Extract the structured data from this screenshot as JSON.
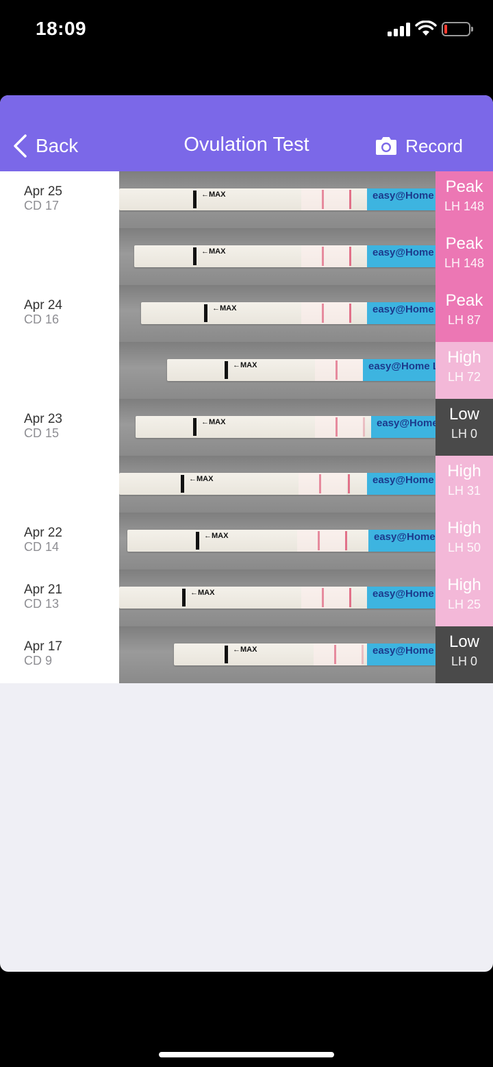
{
  "status_bar": {
    "time": "18:09"
  },
  "nav": {
    "back_label": "Back",
    "title": "Ovulation Test",
    "record_label": "Record"
  },
  "colors": {
    "nav": "#7b68e8",
    "peak": "#ec77b4",
    "high": "#f3b8d8",
    "low": "#4a4a4a"
  },
  "strip_text": {
    "max": "←MAX",
    "brand": "easy@Home LH"
  },
  "tests": [
    {
      "date": "Apr 25",
      "cd": "CD 17",
      "level": "Peak",
      "lh": "LH 148"
    },
    {
      "date": "",
      "cd": "",
      "level": "Peak",
      "lh": "LH 148"
    },
    {
      "date": "Apr 24",
      "cd": "CD 16",
      "level": "Peak",
      "lh": "LH 87"
    },
    {
      "date": "",
      "cd": "",
      "level": "High",
      "lh": "LH 72"
    },
    {
      "date": "Apr 23",
      "cd": "CD 15",
      "level": "Low",
      "lh": "LH 0"
    },
    {
      "date": "",
      "cd": "",
      "level": "High",
      "lh": "LH 31"
    },
    {
      "date": "Apr 22",
      "cd": "CD 14",
      "level": "High",
      "lh": "LH 50"
    },
    {
      "date": "Apr 21",
      "cd": "CD 13",
      "level": "High",
      "lh": "LH 25"
    },
    {
      "date": "Apr 17",
      "cd": "CD 9",
      "level": "Low",
      "lh": "LH 0"
    }
  ]
}
